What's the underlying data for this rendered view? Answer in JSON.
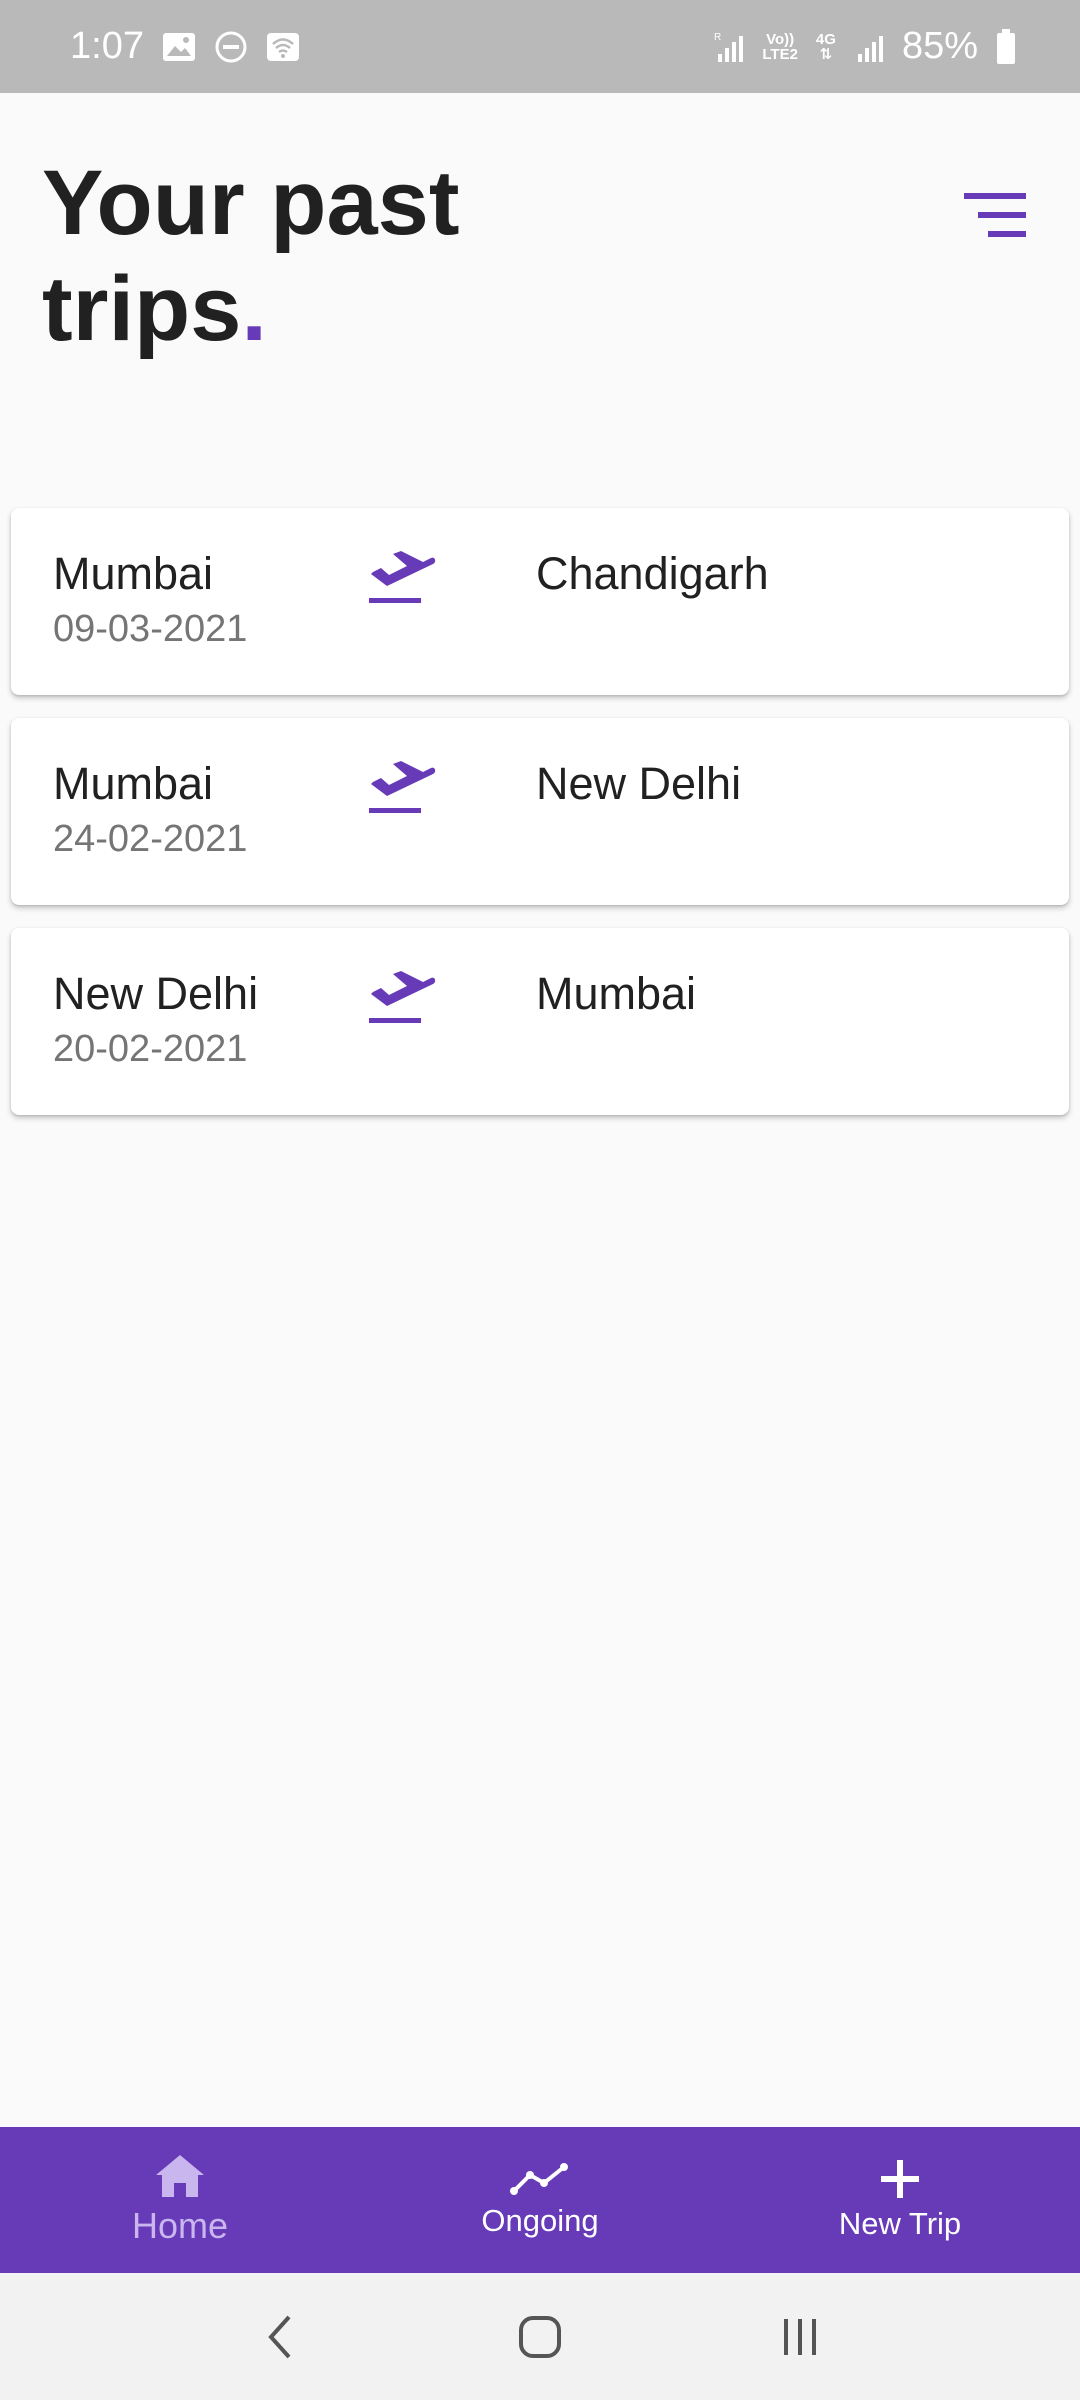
{
  "status_bar": {
    "time": "1:07",
    "battery": "85%",
    "network_top": "Vo))",
    "network_bottom": "LTE2",
    "data_type": "4G"
  },
  "header": {
    "title_line1": "Your past",
    "title_line2": "trips",
    "title_dot": ".",
    "accent_color": "#673ab7"
  },
  "trips": [
    {
      "from": "Mumbai",
      "date": "09-03-2021",
      "to": "Chandigarh"
    },
    {
      "from": "Mumbai",
      "date": "24-02-2021",
      "to": "New Delhi"
    },
    {
      "from": "New Delhi",
      "date": "20-02-2021",
      "to": "Mumbai"
    }
  ],
  "bottom_nav": {
    "items": [
      {
        "label": "Home",
        "icon": "home-icon",
        "active": true
      },
      {
        "label": "Ongoing",
        "icon": "trend-icon",
        "active": false
      },
      {
        "label": "New Trip",
        "icon": "plus-icon",
        "active": false
      }
    ]
  },
  "system_nav": {
    "icons": [
      "back-icon",
      "home-circle-icon",
      "recents-icon"
    ]
  }
}
